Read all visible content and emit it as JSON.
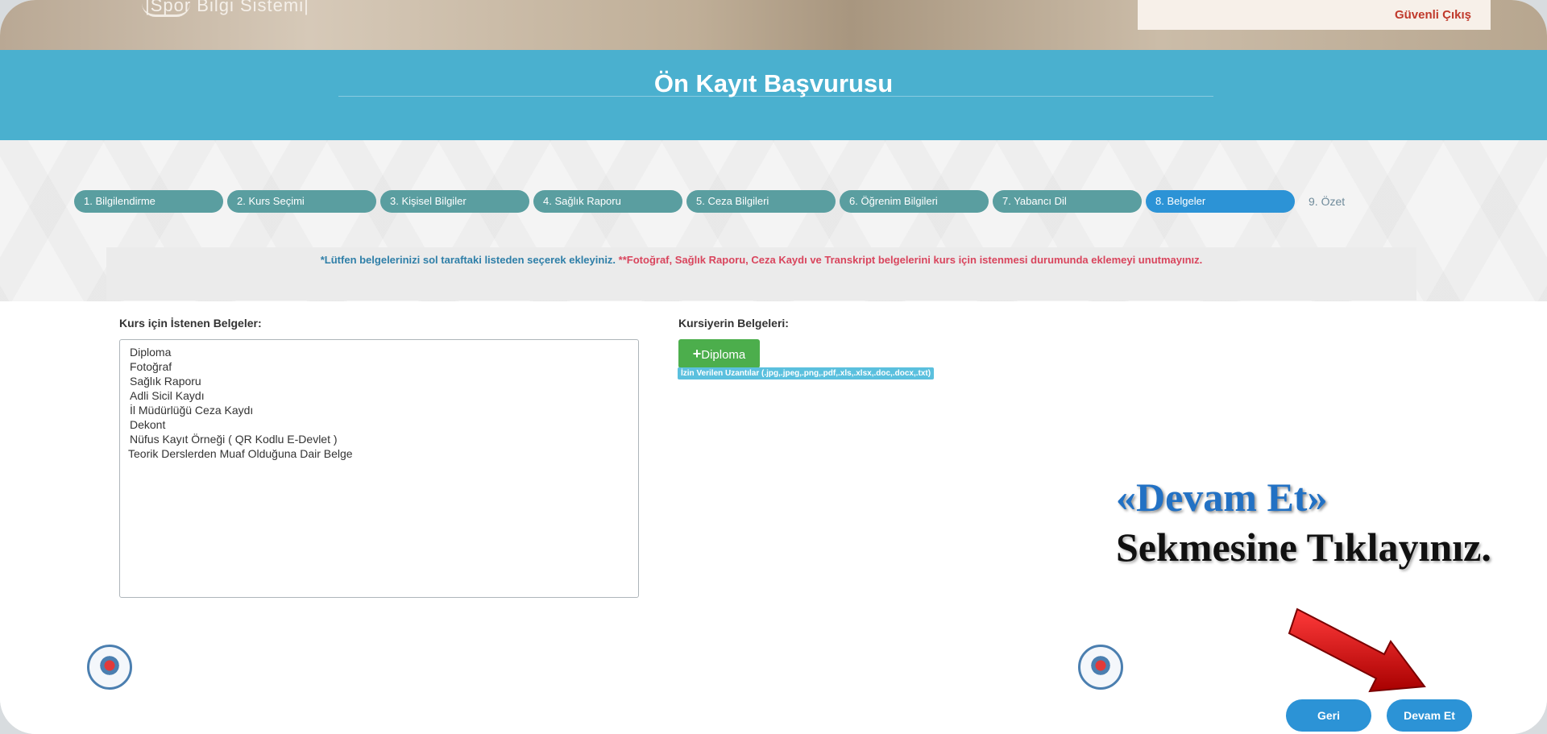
{
  "header": {
    "app_name": "|Spor Bilgi Sistemi|",
    "logout": "Güvenli Çıkış",
    "page_title": "Ön Kayıt Başvurusu"
  },
  "steps": [
    {
      "label": "1. Bilgilendirme",
      "active": false
    },
    {
      "label": "2. Kurs Seçimi",
      "active": false
    },
    {
      "label": "3. Kişisel Bilgiler",
      "active": false
    },
    {
      "label": "4. Sağlık Raporu",
      "active": false
    },
    {
      "label": "5. Ceza Bilgileri",
      "active": false
    },
    {
      "label": "6. Öğrenim Bilgileri",
      "active": false
    },
    {
      "label": "7. Yabancı Dil",
      "active": false
    },
    {
      "label": "8. Belgeler",
      "active": true
    },
    {
      "label": "9. Özet",
      "active": false
    }
  ],
  "notice": {
    "part1": "*Lütfen belgelerinizi sol taraftaki listeden seçerek ekleyiniz.",
    "part2": "**Fotoğraf, Sağlık Raporu, Ceza Kaydı ve Transkript belgelerini kurs için istenmesi durumunda eklemeyi unutmayınız."
  },
  "required_docs": {
    "label": "Kurs için İstenen Belgeler:",
    "items": [
      "Diploma",
      "Fotoğraf",
      "Sağlık Raporu",
      "Adli Sicil Kaydı",
      "İl Müdürlüğü Ceza Kaydı",
      "Dekont",
      "Nüfus Kayıt Örneği ( QR Kodlu E-Devlet )",
      "Teorik Derslerden Muaf Olduğuna Dair Belge"
    ]
  },
  "trainee_docs": {
    "label": "Kursiyerin Belgeleri:",
    "add_button": "Diploma",
    "allowed_ext": "İzin Verilen Uzantılar (.jpg,.jpeg,.png,.pdf,.xls,.xlsx,.doc,.docx,.txt)"
  },
  "instruction": {
    "line1": "«Devam Et»",
    "line2": "Sekmesine Tıklayınız."
  },
  "buttons": {
    "back": "Geri",
    "continue": "Devam Et"
  },
  "colors": {
    "title_band": "#4ab0cf",
    "step": "#5a9ea0",
    "step_active": "#2c93d6",
    "add_button": "#4cae4c",
    "notice_red": "#d9455d",
    "arrow": "#d10f0f"
  },
  "icons": [
    "plus-icon",
    "emblem-logo",
    "red-arrow-icon"
  ]
}
